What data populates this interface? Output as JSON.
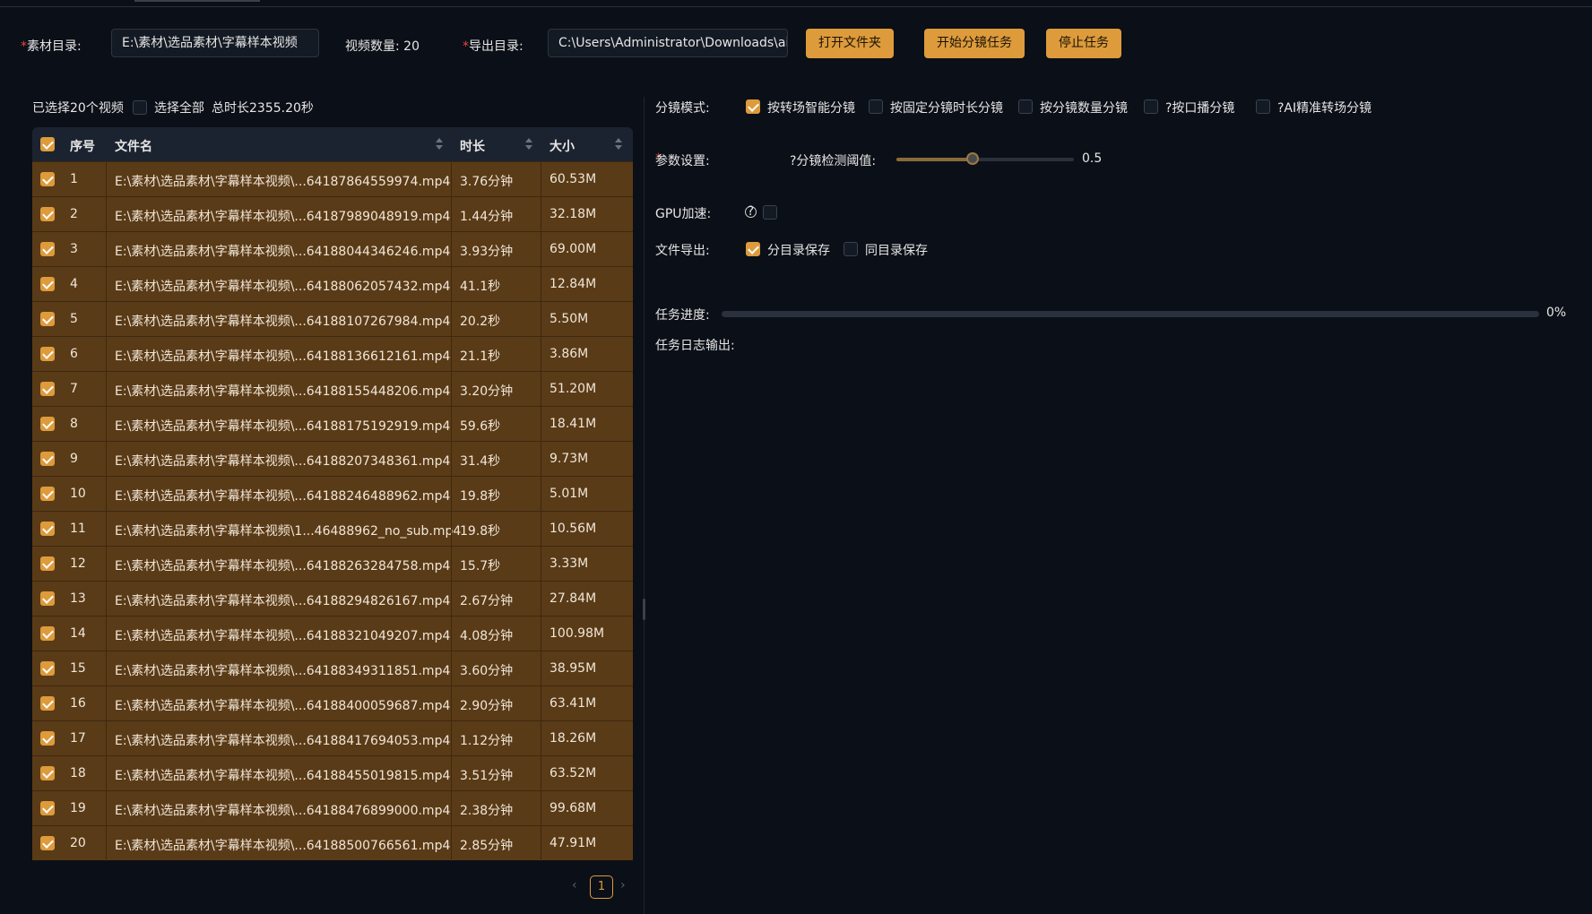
{
  "toolbar": {
    "source_label": "素材目录:",
    "source_value": "E:\\素材\\选品素材\\字幕样本视频",
    "video_count_label": "视频数量:",
    "video_count": "20",
    "export_label": "导出目录:",
    "export_value": "C:\\Users\\Administrator\\Downloads\\aim",
    "open_folder_button": "打开文件夹",
    "start_button": "开始分镜任务",
    "stop_button": "停止任务",
    "required_mark": "*",
    "accent_color": "#dd9b3c"
  },
  "selection": {
    "selected_text": "已选择20个视频",
    "select_all_label": "选择全部",
    "total_duration": "总时长2355.20秒"
  },
  "table": {
    "headers": {
      "index": "序号",
      "filename": "文件名",
      "duration": "时长",
      "size": "大小"
    },
    "rows": [
      {
        "index": "1",
        "filename": "E:\\素材\\选品素材\\字幕样本视频\\...64187864559974.mp4",
        "duration": "3.76分钟",
        "size": "60.53M"
      },
      {
        "index": "2",
        "filename": "E:\\素材\\选品素材\\字幕样本视频\\...64187989048919.mp4",
        "duration": "1.44分钟",
        "size": "32.18M"
      },
      {
        "index": "3",
        "filename": "E:\\素材\\选品素材\\字幕样本视频\\...64188044346246.mp4",
        "duration": "3.93分钟",
        "size": "69.00M"
      },
      {
        "index": "4",
        "filename": "E:\\素材\\选品素材\\字幕样本视频\\...64188062057432.mp4",
        "duration": "41.1秒",
        "size": "12.84M"
      },
      {
        "index": "5",
        "filename": "E:\\素材\\选品素材\\字幕样本视频\\...64188107267984.mp4",
        "duration": "20.2秒",
        "size": "5.50M"
      },
      {
        "index": "6",
        "filename": "E:\\素材\\选品素材\\字幕样本视频\\...64188136612161.mp4",
        "duration": "21.1秒",
        "size": "3.86M"
      },
      {
        "index": "7",
        "filename": "E:\\素材\\选品素材\\字幕样本视频\\...64188155448206.mp4",
        "duration": "3.20分钟",
        "size": "51.20M"
      },
      {
        "index": "8",
        "filename": "E:\\素材\\选品素材\\字幕样本视频\\...64188175192919.mp4",
        "duration": "59.6秒",
        "size": "18.41M"
      },
      {
        "index": "9",
        "filename": "E:\\素材\\选品素材\\字幕样本视频\\...64188207348361.mp4",
        "duration": "31.4秒",
        "size": "9.73M"
      },
      {
        "index": "10",
        "filename": "E:\\素材\\选品素材\\字幕样本视频\\...64188246488962.mp4",
        "duration": "19.8秒",
        "size": "5.01M"
      },
      {
        "index": "11",
        "filename": "E:\\素材\\选品素材\\字幕样本视频\\1...46488962_no_sub.mp4",
        "duration": "19.8秒",
        "size": "10.56M"
      },
      {
        "index": "12",
        "filename": "E:\\素材\\选品素材\\字幕样本视频\\...64188263284758.mp4",
        "duration": "15.7秒",
        "size": "3.33M"
      },
      {
        "index": "13",
        "filename": "E:\\素材\\选品素材\\字幕样本视频\\...64188294826167.mp4",
        "duration": "2.67分钟",
        "size": "27.84M"
      },
      {
        "index": "14",
        "filename": "E:\\素材\\选品素材\\字幕样本视频\\...64188321049207.mp4",
        "duration": "4.08分钟",
        "size": "100.98M"
      },
      {
        "index": "15",
        "filename": "E:\\素材\\选品素材\\字幕样本视频\\...64188349311851.mp4",
        "duration": "3.60分钟",
        "size": "38.95M"
      },
      {
        "index": "16",
        "filename": "E:\\素材\\选品素材\\字幕样本视频\\...64188400059687.mp4",
        "duration": "2.90分钟",
        "size": "63.41M"
      },
      {
        "index": "17",
        "filename": "E:\\素材\\选品素材\\字幕样本视频\\...64188417694053.mp4",
        "duration": "1.12分钟",
        "size": "18.26M"
      },
      {
        "index": "18",
        "filename": "E:\\素材\\选品素材\\字幕样本视频\\...64188455019815.mp4",
        "duration": "3.51分钟",
        "size": "63.52M"
      },
      {
        "index": "19",
        "filename": "E:\\素材\\选品素材\\字幕样本视频\\...64188476899000.mp4",
        "duration": "2.38分钟",
        "size": "99.68M"
      },
      {
        "index": "20",
        "filename": "E:\\素材\\选品素材\\字幕样本视频\\...64188500766561.mp4",
        "duration": "2.85分钟",
        "size": "47.91M"
      }
    ]
  },
  "pagination": {
    "current_page": "1"
  },
  "split_mode": {
    "label": "分镜模式:",
    "options": [
      {
        "label": "按转场智能分镜",
        "checked": true
      },
      {
        "label": "按固定分镜时长分镜",
        "checked": false
      },
      {
        "label": "按分镜数量分镜",
        "checked": false
      },
      {
        "label": "?按口播分镜",
        "checked": false
      },
      {
        "label": "?AI精准转场分镜",
        "checked": false
      }
    ]
  },
  "params": {
    "label": "参数设置:",
    "threshold_label": "?分镜检测阈值:",
    "threshold_value": "0.5",
    "threshold_fraction": 0.43
  },
  "gpu": {
    "label": "GPU加速:",
    "help_icon": "?",
    "checked": false
  },
  "file_export": {
    "label": "文件导出:",
    "options": [
      {
        "label": "分目录保存",
        "checked": true
      },
      {
        "label": "同目录保存",
        "checked": false
      }
    ]
  },
  "progress": {
    "label": "任务进度:",
    "percent_text": "0%",
    "fraction": 0
  },
  "log": {
    "label": "任务日志输出:"
  }
}
